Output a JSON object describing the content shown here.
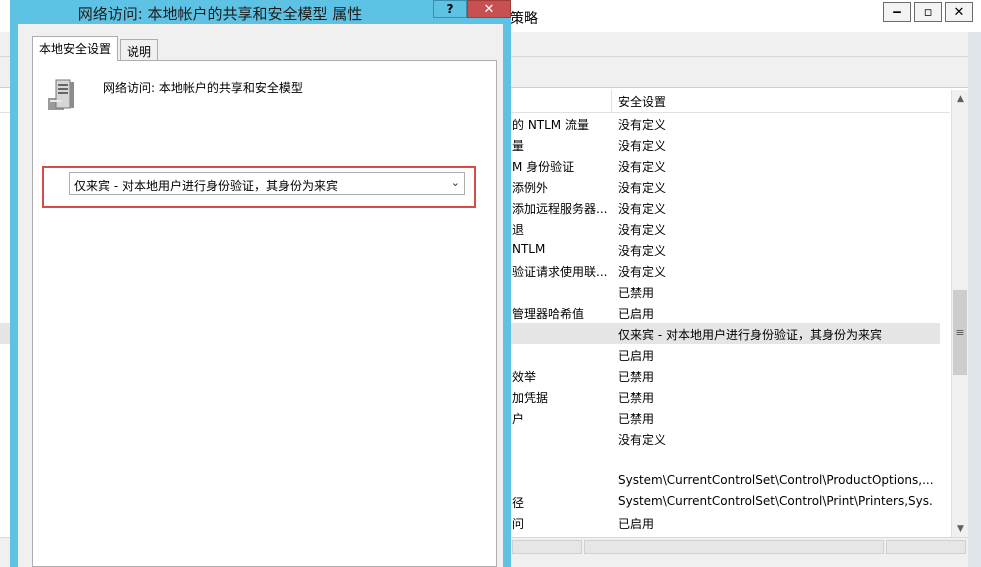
{
  "background_window": {
    "title": "策略",
    "controls": {
      "minimize": "‒",
      "maximize": "▫",
      "close": "✕"
    },
    "column_header": "安全设置",
    "rows": [
      {
        "name": "的 NTLM 流量",
        "value": "没有定义"
      },
      {
        "name": "量",
        "value": "没有定义"
      },
      {
        "name": "M 身份验证",
        "value": "没有定义"
      },
      {
        "name": "添例外",
        "value": "没有定义"
      },
      {
        "name": "添加远程服务器...",
        "value": "没有定义"
      },
      {
        "name": "退",
        "value": "没有定义"
      },
      {
        "name": "NTLM",
        "value": "没有定义"
      },
      {
        "name": "验证请求使用联...",
        "value": "没有定义"
      },
      {
        "name": "",
        "value": "已禁用"
      },
      {
        "name": "管理器哈希值",
        "value": "已启用"
      },
      {
        "name": "",
        "value": "仅来宾 - 对本地用户进行身份验证，其身份为来宾",
        "selected": true
      },
      {
        "name": "",
        "value": "已启用"
      },
      {
        "name": "效举",
        "value": "已禁用"
      },
      {
        "name": "加凭据",
        "value": "已禁用"
      },
      {
        "name": "户",
        "value": "已禁用"
      },
      {
        "name": "",
        "value": "没有定义"
      },
      {
        "name": "",
        "value": ""
      },
      {
        "name": "",
        "value": "System\\CurrentControlSet\\Control\\ProductOptions,..."
      },
      {
        "name": "径",
        "value": "System\\CurrentControlSet\\Control\\Print\\Printers,Sys..."
      },
      {
        "name": "问",
        "value": "已启用"
      }
    ]
  },
  "dialog": {
    "title": "网络访问: 本地帐户的共享和安全模型 属性",
    "help_label": "?",
    "close_label": "✕",
    "tabs": [
      "本地安全设置",
      "说明"
    ],
    "policy_name": "网络访问: 本地帐户的共享和安全模型",
    "dropdown": {
      "selected": "仅来宾 - 对本地用户进行身份验证，其身份为来宾"
    }
  },
  "colors": {
    "dialog_frame": "#5ec2e4",
    "close_button": "#c75050",
    "highlight_box": "#d94a4a",
    "selected_row": "#e5e5e5"
  }
}
